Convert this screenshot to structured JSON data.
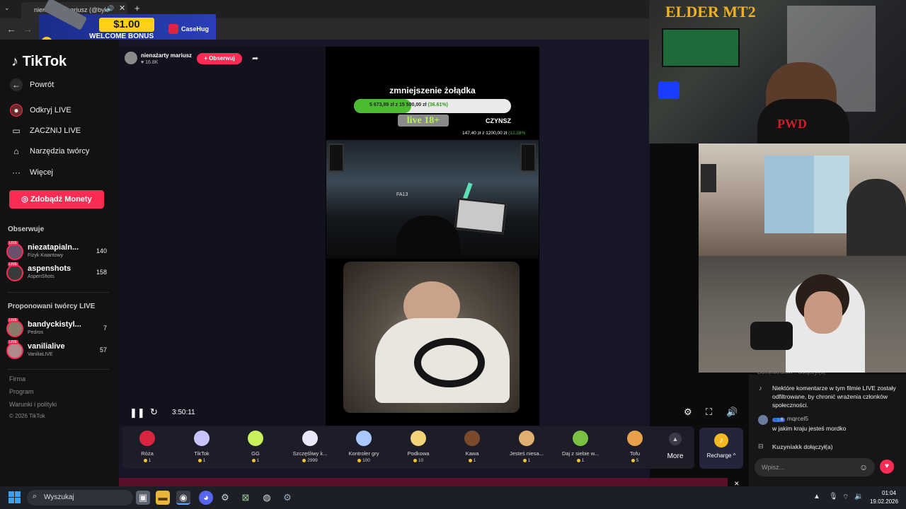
{
  "browser": {
    "tab_title": "nienażarty mariusz (@byk",
    "ad": {
      "amount": "$1.00",
      "tagline": "WELCOME BONUS",
      "brand": "CaseHug"
    }
  },
  "sidebar": {
    "logo": "TikTok",
    "items": [
      {
        "label": "Powrót",
        "icon": "arrow-left-icon"
      },
      {
        "label": "Odkryj LIVE",
        "icon": "live-icon"
      },
      {
        "label": "ZACZNIJ LIVE",
        "icon": "camera-icon"
      },
      {
        "label": "Narzędzia twórcy",
        "icon": "home-icon"
      },
      {
        "label": "Więcej",
        "icon": "more-icon"
      }
    ],
    "coins_button": "Zdobądź Monety",
    "following_title": "Obserwuje",
    "following": [
      {
        "name": "niezatapialn...",
        "sub": "Fizyk Kwantowy",
        "count": "140"
      },
      {
        "name": "aspenshots",
        "sub": "AspenShots",
        "count": "158"
      }
    ],
    "suggested_title": "Proponowani twórcy LIVE",
    "suggested": [
      {
        "name": "bandyckistyl...",
        "sub": "Pedros",
        "count": "7"
      },
      {
        "name": "vanilialive",
        "sub": "VaniliaLIVE",
        "count": "57"
      }
    ],
    "footer": [
      "Firma",
      "Program",
      "Warunki i polityki",
      "© 2026 TikTok"
    ]
  },
  "stream": {
    "streamer_name": "nienażarty mariusz",
    "likes": "16.8K",
    "follow_label": "+ Obserwuj",
    "goal_title": "zmniejszenie żołądka",
    "goal_text": "5 673,89 zł  z  15 500,00 zł",
    "goal_pct_text": "(36.61%)",
    "goal_progress": 0.3661,
    "live_badge": "live 18+",
    "rent_title": "CZYNSZ",
    "rent_text": "147,40 zł  z  1200,00 zł",
    "rent_pct_text": "(12.28%",
    "game_sign": "FA13",
    "time": "3:50:11"
  },
  "gifts": [
    {
      "name": "Róża",
      "price": "1",
      "icon": "rose-icon",
      "color": "#d7263d"
    },
    {
      "name": "TikTok",
      "price": "1",
      "icon": "tiktok-gift-icon",
      "color": "#c9c3ff"
    },
    {
      "name": "GG",
      "price": "1",
      "icon": "gg-icon",
      "color": "#c8f05a"
    },
    {
      "name": "Szczęśliwy k...",
      "price": "2999",
      "icon": "horse-icon",
      "color": "#e8e8f8"
    },
    {
      "name": "Kontroler gry",
      "price": "100",
      "icon": "gamepad-icon",
      "color": "#a9c8ff"
    },
    {
      "name": "Podkowa",
      "price": "10",
      "icon": "horseshoe-icon",
      "color": "#f3d27a"
    },
    {
      "name": "Kawa",
      "price": "1",
      "icon": "coffee-icon",
      "color": "#7a4a2a"
    },
    {
      "name": "Jesteś niesa...",
      "price": "1",
      "icon": "cat-icon",
      "color": "#e0b070"
    },
    {
      "name": "Daj z siebie w...",
      "price": "1",
      "icon": "medal-icon",
      "color": "#7ac143"
    },
    {
      "name": "Tofu",
      "price": "5",
      "icon": "dog-icon",
      "color": "#e8a04a"
    }
  ],
  "more_label": "More",
  "recharge_label": "Recharge",
  "chat": {
    "top_partial": "Dominiknikow...  dołączył(a)",
    "system_msg": "Niektóre komentarze w tym filmie LIVE zostały odfiltrowane, by chronić wrażenia członków społeczności.",
    "user_msg": {
      "user": "mqrcel5",
      "level": "8",
      "text": "w jakim kraju jesteś mordko"
    },
    "join_msg": {
      "user": "Kuzyniakk",
      "action": "dołączył(a)"
    },
    "placeholder": "Wpisz..."
  },
  "webcam": {
    "title": "ELDER MT2",
    "shirt": "PWD"
  },
  "taskbar": {
    "search_placeholder": "Wyszukaj",
    "time": "01:04",
    "date": "19.02.2026"
  }
}
